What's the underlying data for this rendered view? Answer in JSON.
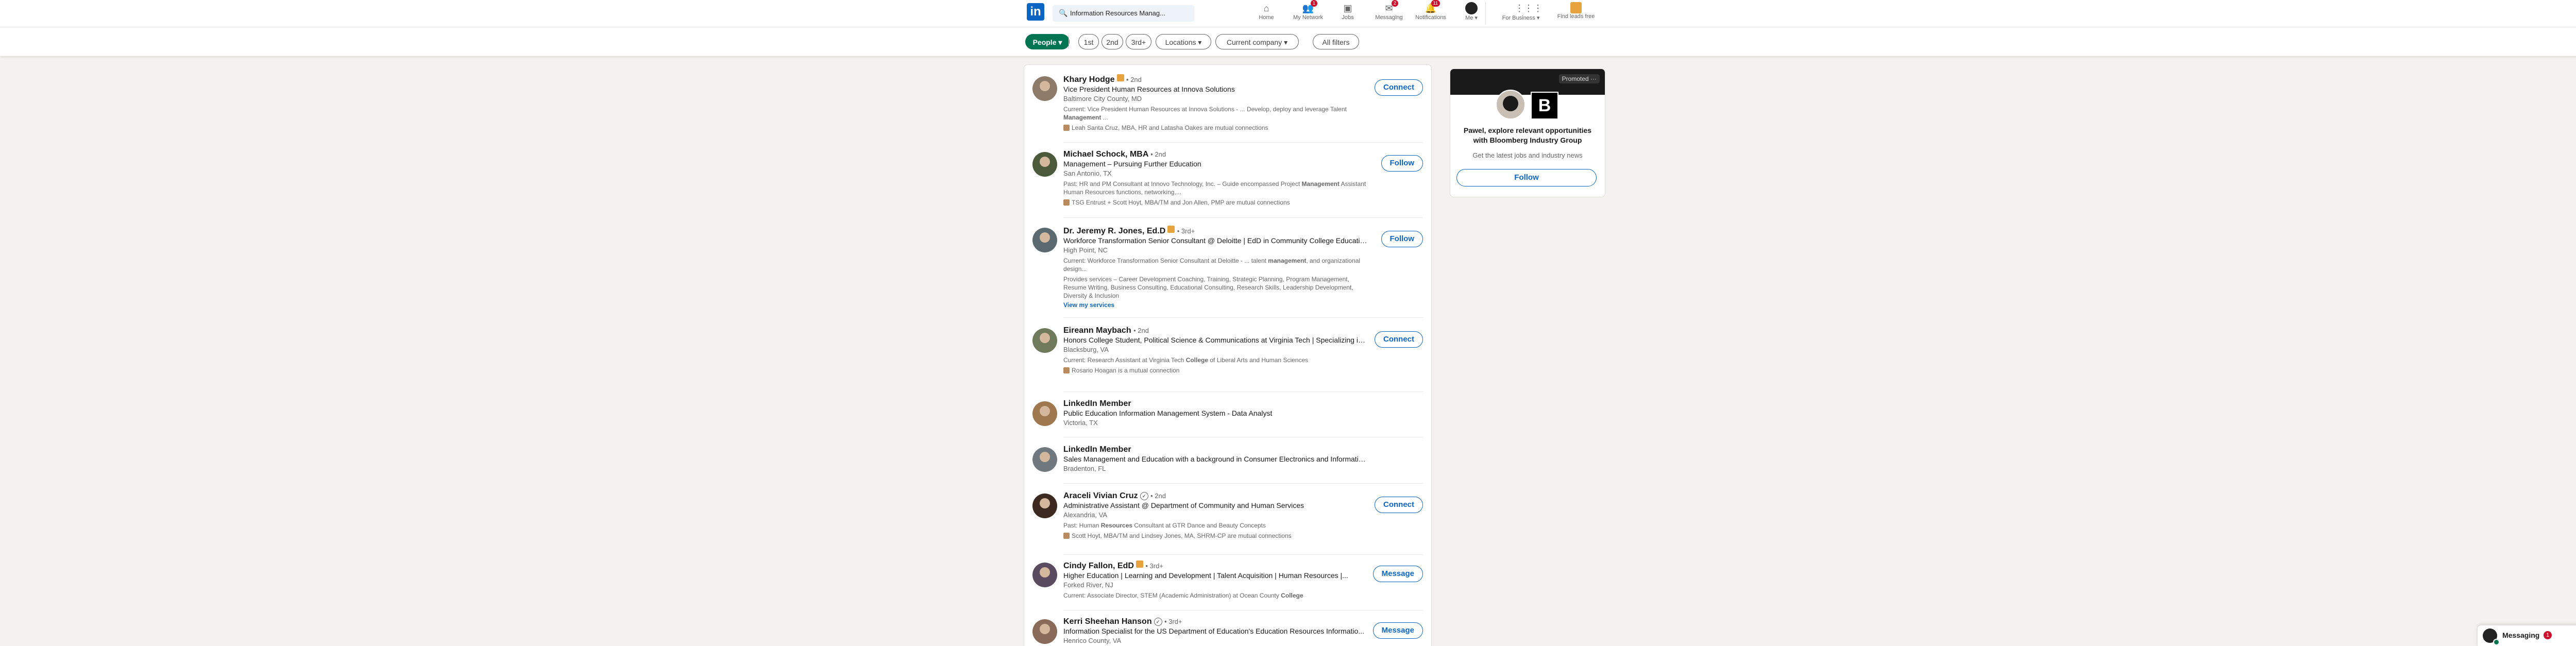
{
  "nav": {
    "logo_text": "in",
    "search_value": "Information Resources Manag...",
    "items": [
      {
        "label": "Home",
        "icon": "home-icon",
        "glyph": "⌂",
        "badge": ""
      },
      {
        "label": "My Network",
        "icon": "network-icon",
        "glyph": "👥",
        "badge": "1"
      },
      {
        "label": "Jobs",
        "icon": "briefcase-icon",
        "glyph": "▣",
        "badge": ""
      },
      {
        "label": "Messaging",
        "icon": "messaging-icon",
        "glyph": "✉",
        "badge": "2"
      },
      {
        "label": "Notifications",
        "icon": "bell-icon",
        "glyph": "🔔",
        "badge": "11"
      }
    ],
    "me_label": "Me ▾",
    "business_label": "For Business ▾",
    "premium_label": "Find leads free"
  },
  "filters": {
    "people": "People ▾",
    "first": "1st",
    "second": "2nd",
    "third": "3rd+",
    "locations": "Locations ▾",
    "current_company": "Current company ▾",
    "all_filters": "All filters"
  },
  "results": [
    {
      "name": "Khary Hodge",
      "degree": "• 2nd",
      "headline": "Vice President Human Resources at Innova Solutions",
      "location": "Baltimore City County, MD",
      "summary_pre": "Current: Vice President Human Resources at Innova Solutions - ... Develop, deploy and leverage Talent ",
      "summary_bold": "Management",
      "summary_post": " ...",
      "mutual": "Leah Santa Cruz, MBA, HR and Latasha Oakes are mutual connections",
      "action": "Connect"
    },
    {
      "name": "Michael Schock, MBA",
      "degree": "• 2nd",
      "headline": "Management – Pursuing Further Education",
      "location": "San Antonio, TX",
      "summary_pre": "Past: HR and PM Consultant at Innovo Technology, Inc. – Guide encompassed Project ",
      "summary_bold": "Management",
      "summary_post": " Assistant Human Resources functions, networking,...",
      "mutual": "TSG Entrust + Scott Hoyt, MBA/TM and Jon Allen, PMP are mutual connections",
      "action": "Follow"
    },
    {
      "name": "Dr. Jeremy R. Jones, Ed.D",
      "degree": "• 3rd+",
      "headline": "Workforce Transformation Senior Consultant @ Deloitte | EdD in Community College Education",
      "location": "High Point, NC",
      "summary_pre": "Current: Workforce Transformation Senior Consultant at Deloitte - ... talent ",
      "summary_bold": "management",
      "summary_post": ", and organizational design...",
      "services": "Provides services – Career Development Coaching, Training, Strategic Planning, Program Management, Resume Writing, Business Consulting, Educational Consulting, Research Skills, Leadership Development, Diversity & Inclusion",
      "link": "View my services",
      "action": "Follow"
    },
    {
      "name": "Eireann Maybach",
      "degree": "• 2nd",
      "headline": "Honors College Student, Political Science & Communications at Virginia Tech | Specializing in...",
      "location": "Blacksburg, VA",
      "summary_pre": "Current: Research Assistant at Virginia Tech ",
      "summary_bold": "College",
      "summary_post": " of Liberal Arts and Human Sciences",
      "mutual": "Rosario Hoagan is a mutual connection",
      "action": "Connect"
    },
    {
      "name": "LinkedIn Member",
      "degree": "",
      "headline": "Public Education Information Management System - Data Analyst",
      "location": "Victoria, TX",
      "action": ""
    },
    {
      "name": "LinkedIn Member",
      "degree": "",
      "headline": "Sales Management and Education with a background in Consumer Electronics and Information...",
      "location": "Bradenton, FL",
      "action": ""
    },
    {
      "name": "Araceli Vivian Cruz",
      "degree": "• 2nd",
      "headline": "Administrative Assistant @ Department of Community and Human Services",
      "location": "Alexandria, VA",
      "summary_pre": "Past: Human ",
      "summary_bold": "Resources",
      "summary_post": " Consultant at GTR Dance and Beauty Concepts",
      "mutual": "Scott Hoyt, MBA/TM and Lindsey Jones, MA, SHRM-CP are mutual connections",
      "action": "Connect"
    },
    {
      "name": "Cindy Fallon, EdD",
      "degree": "• 3rd+",
      "headline": "Higher Education | Learning and Development | Talent Acquisition | Human Resources |...",
      "location": "Forked River, NJ",
      "summary_pre": "Current: Associate Director, STEM (Academic Administration) at Ocean County ",
      "summary_bold": "College",
      "summary_post": "",
      "action": "Message"
    },
    {
      "name": "Kerri Sheehan Hanson",
      "degree": "• 3rd+",
      "headline": "Information Specialist for the US Department of Education's Education Resources Informatio...",
      "location": "Henrico County, VA",
      "action": "Message"
    }
  ],
  "promo": {
    "tag": "Promoted ···",
    "logo_letter": "B",
    "headline": "Pawel, explore relevant opportunities with Bloomberg Industry Group",
    "sub": "Get the latest jobs and industry news",
    "button": "Follow"
  },
  "messaging": {
    "label": "Messaging",
    "count": "1",
    "more": "···",
    "compose": "✎",
    "collapse": "︿"
  },
  "colors": {
    "brand": "#0a66c2",
    "active_filter": "#01754f",
    "badge": "#cb112d"
  }
}
